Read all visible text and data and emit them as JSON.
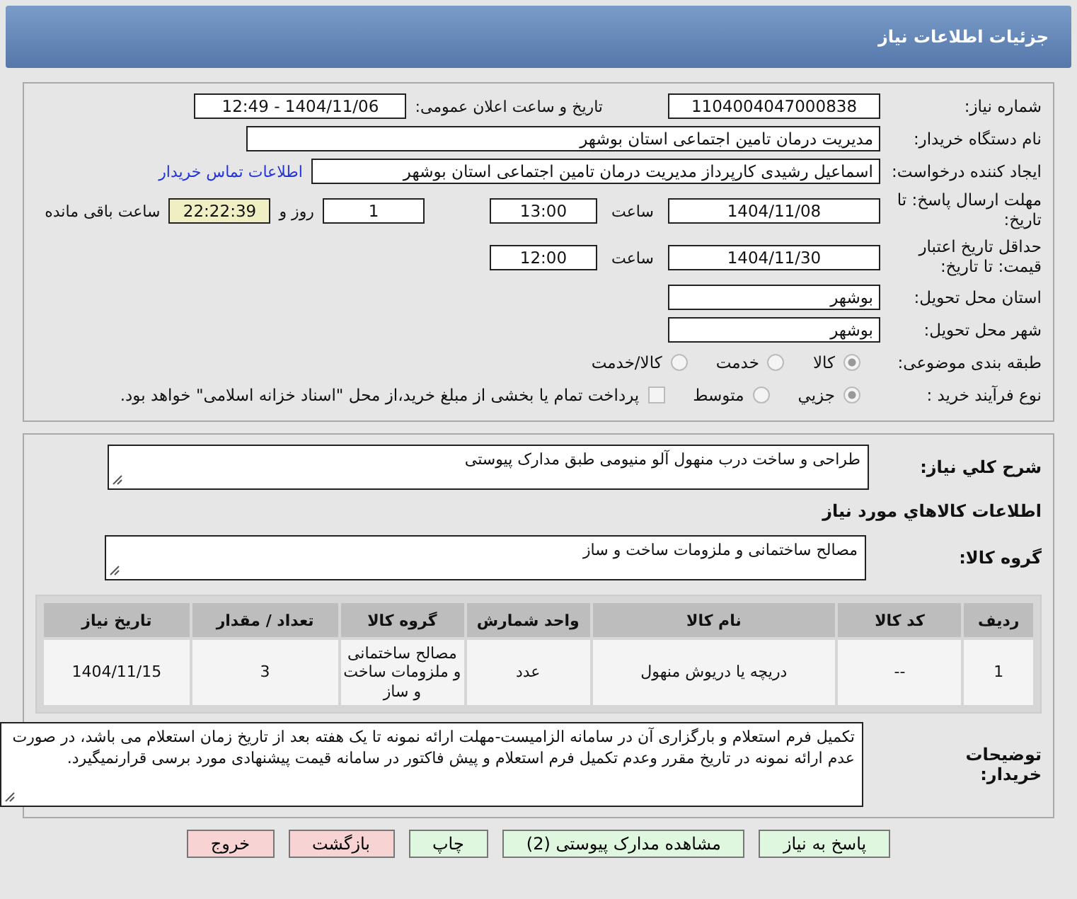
{
  "title": "جزئیات اطلاعات نیاز",
  "need_number": {
    "label": "شماره نیاز:",
    "value": "1104004047000838"
  },
  "announce": {
    "label": "تاریخ و ساعت اعلان عمومی:",
    "value": "1404/11/06 - 12:49"
  },
  "buyer": {
    "label": "نام دستگاه خریدار:",
    "value": "مدیریت درمان تامین اجتماعی استان بوشهر"
  },
  "requester": {
    "label": "ایجاد کننده درخواست:",
    "value": "اسماعیل رشیدی کارپرداز مدیریت درمان تامین اجتماعی استان بوشهر",
    "link": "اطلاعات تماس خریدار"
  },
  "deadline": {
    "label": "مهلت ارسال پاسخ: تا تاریخ:",
    "date": "1404/11/08",
    "time_label": "ساعت",
    "time": "13:00",
    "days": "1",
    "days_label": "روز و",
    "remaining": "22:22:39",
    "remaining_label": "ساعت باقی مانده"
  },
  "validity": {
    "label": "حداقل تاریخ اعتبار قیمت: تا تاریخ:",
    "date": "1404/11/30",
    "time_label": "ساعت",
    "time": "12:00"
  },
  "province": {
    "label": "استان محل تحویل:",
    "value": "بوشهر"
  },
  "city": {
    "label": "شهر محل تحویل:",
    "value": "بوشهر"
  },
  "category": {
    "label": "طبقه بندی موضوعی:",
    "options": [
      {
        "label": "کالا",
        "selected": true
      },
      {
        "label": "خدمت",
        "selected": false
      },
      {
        "label": "کالا/خدمت",
        "selected": false
      }
    ]
  },
  "process": {
    "label": "نوع فرآیند خرید :",
    "options": [
      {
        "label": "جزیي",
        "selected": true
      },
      {
        "label": "متوسط",
        "selected": false
      }
    ],
    "checkbox": {
      "checked": false,
      "label": "پرداخت تمام یا بخشی از مبلغ خرید،از محل \"اسناد خزانه اسلامی\" خواهد بود."
    }
  },
  "description": {
    "label": "شرح كلي نياز:",
    "value": "طراحی و ساخت درب منهول آلو منیومی طبق مدارک پیوستی"
  },
  "goods_heading": "اطلاعات كالاهاي مورد نياز",
  "goods_group": {
    "label": "گروه کالا:",
    "value": "مصالح ساختمانی و ملزومات ساخت و ساز"
  },
  "table": {
    "columns": [
      "ردیف",
      "کد کالا",
      "نام کالا",
      "واحد شمارش",
      "گروه کالا",
      "تعداد / مقدار",
      "تاریخ نیاز"
    ],
    "rows": [
      [
        "1",
        "--",
        "دریچه یا دریوش منهول",
        "عدد",
        "مصالح ساختمانی و ملزومات ساخت و ساز",
        "3",
        "1404/11/15"
      ]
    ]
  },
  "buyer_notes": {
    "label": "توضیحات خریدار:",
    "value": "تکمیل فرم استعلام و بارگزاری آن در سامانه الزامیست-مهلت ارائه نمونه تا یک هفته بعد از تاریخ زمان استعلام می باشد، در صورت عدم ارائه نمونه در تاریخ مقرر وعدم تکمیل فرم استعلام و پیش فاکتور در سامانه  قیمت پیشنهادی مورد برسی قرارنمیگیرد."
  },
  "buttons": [
    {
      "label": "پاسخ به نیاز",
      "kind": "action"
    },
    {
      "label": "مشاهده مدارک پیوستی (2)",
      "kind": "action"
    },
    {
      "label": "چاپ",
      "kind": "action"
    },
    {
      "label": "بازگشت",
      "kind": "exit"
    },
    {
      "label": "خروج",
      "kind": "exit"
    }
  ]
}
